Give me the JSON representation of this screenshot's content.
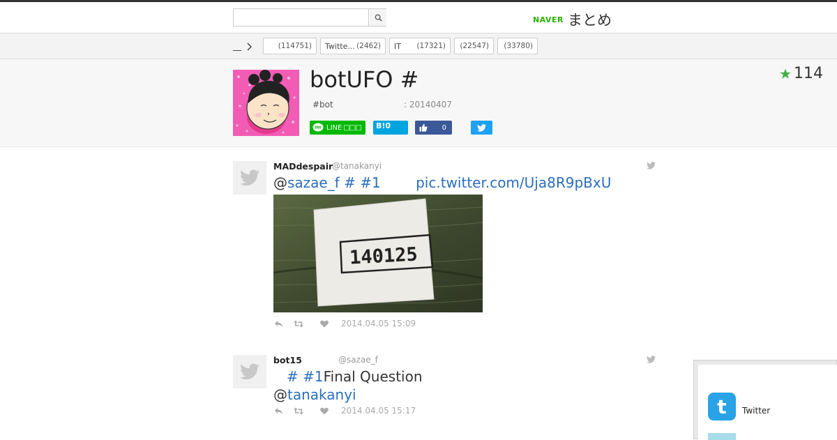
{
  "header": {
    "search_placeholder": "",
    "logo_brand": "NAVER",
    "logo_text": "まとめ"
  },
  "categories": {
    "home_label": "__",
    "tags": [
      {
        "label": "",
        "count": "(114751)"
      },
      {
        "label": "Twitte...",
        "count": "(2462)"
      },
      {
        "label": "IT",
        "count": "(17321)"
      },
      {
        "label": "",
        "count": "(22547)"
      },
      {
        "label": "",
        "count": "(33780)"
      }
    ]
  },
  "matome": {
    "title": "botUFO #",
    "tagline": "#bot",
    "date": ": 20140407",
    "favorite_count": "114",
    "share": {
      "line_label": "LINE",
      "hatena_label": "B!",
      "hatena_count": "0",
      "like_count": "0"
    }
  },
  "tweets": [
    {
      "name": "MADdespair",
      "handle": "@tanakanyi",
      "text_prefix": "@",
      "mention": "sazae_f",
      "hash1": "#",
      "hash2": "#1",
      "link": "pic.twitter.com/Uja8R9pBxU",
      "timestamp": "2014.04.05 15:09",
      "photo_text": "140125"
    },
    {
      "name": "bot15",
      "handle": "@sazae_f",
      "hash1": "#",
      "hash2": "#1",
      "line1_suffix": "Final Question",
      "line2_prefix": "@",
      "mention": "tanakanyi",
      "timestamp": "2014.04.05 15:17"
    }
  ],
  "side_panel": {
    "label": "Twitter"
  },
  "colors": {
    "naver_green": "#2db400",
    "link_blue": "#2a6ebb",
    "line_green": "#00b900",
    "hatena_blue": "#00a4de",
    "facebook_blue": "#3b5998",
    "twitter_blue": "#1da1f2"
  }
}
